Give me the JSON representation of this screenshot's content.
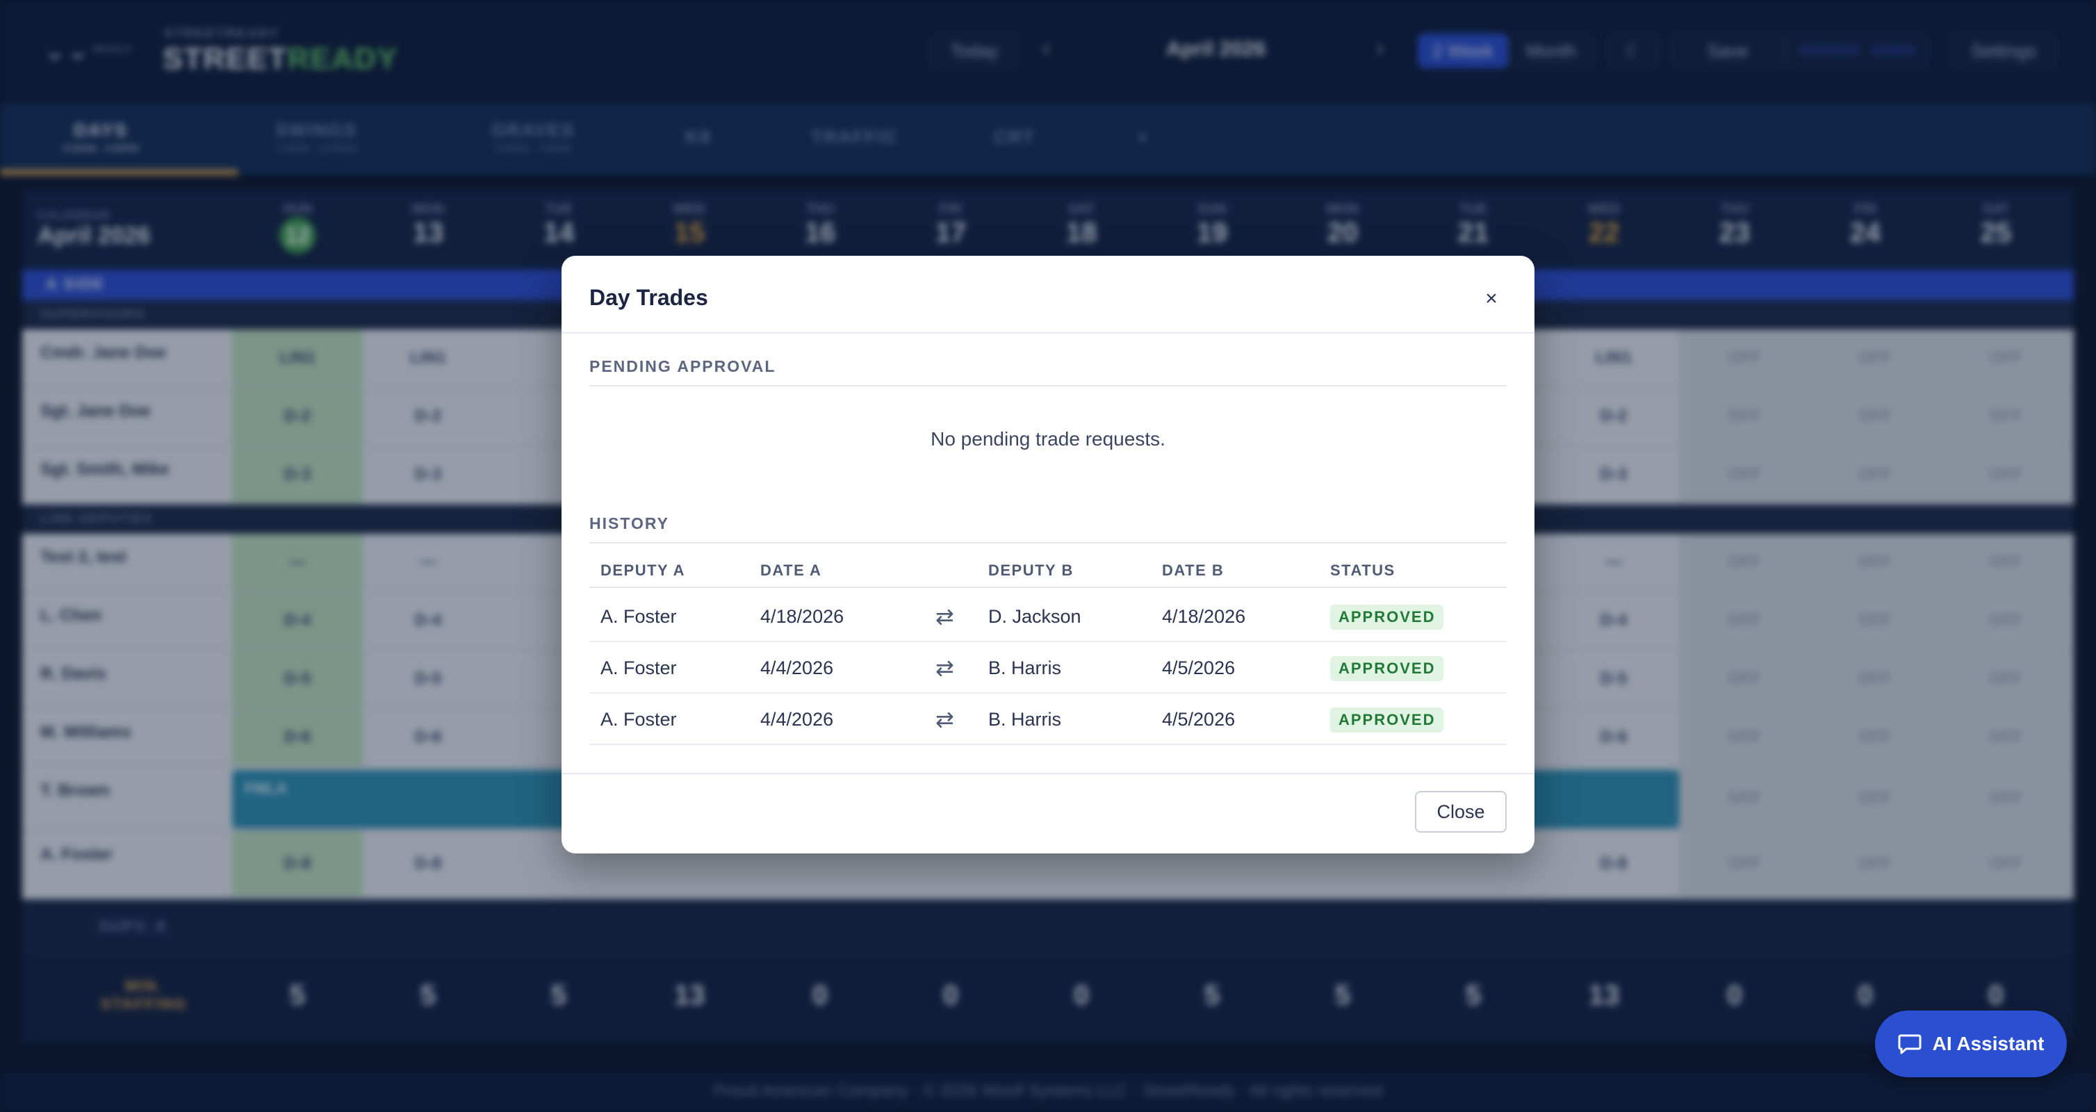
{
  "app": {
    "brand_small": "WOOLF",
    "brand_sub": "STREETREADY",
    "brand_part1": "STREET",
    "brand_part2": "READY",
    "today_label": "Today",
    "month_label": "April 2026",
    "view_week": "2 Week",
    "view_month": "Month",
    "save_label": "Save",
    "user_label": "ANDREW · ADMIN",
    "settings_label": "Settings",
    "tabs": [
      {
        "label": "DAYS",
        "sub": "6:00AM - 4:00PM"
      },
      {
        "label": "SWINGS",
        "sub": "2:00PM - 12:00PM"
      },
      {
        "label": "GRAVES",
        "sub": "9:00PM - 7:00AM"
      },
      {
        "label": "K9",
        "sub": ""
      },
      {
        "label": "TRAFFIC",
        "sub": ""
      },
      {
        "label": "CRT",
        "sub": ""
      },
      {
        "label": "+",
        "sub": ""
      }
    ],
    "calendar_label": "CALENDAR",
    "calendar_month": "April 2026",
    "days": [
      {
        "dn": "SUN",
        "dd": "12"
      },
      {
        "dn": "MON",
        "dd": "13"
      },
      {
        "dn": "TUE",
        "dd": "14"
      },
      {
        "dn": "WED",
        "dd": "15"
      },
      {
        "dn": "THU",
        "dd": "16"
      },
      {
        "dn": "FRI",
        "dd": "17"
      },
      {
        "dn": "SAT",
        "dd": "18"
      },
      {
        "dn": "SUN",
        "dd": "19"
      },
      {
        "dn": "MON",
        "dd": "20"
      },
      {
        "dn": "TUE",
        "dd": "21"
      },
      {
        "dn": "WED",
        "dd": "22"
      },
      {
        "dn": "THU",
        "dd": "23"
      },
      {
        "dn": "FRI",
        "dd": "24"
      },
      {
        "dn": "SAT",
        "dd": "25"
      }
    ],
    "side_a": "A SIDE",
    "supervisors_label": "SUPERVISORS",
    "line_deputies_label": "LINE DEPUTIES",
    "rows": [
      {
        "name": "Cmdr. Jane Doe",
        "code": "LIN1"
      },
      {
        "name": "Sgt. Jane Doe",
        "code": "D-2"
      },
      {
        "name": "Sgt. Smith, Mike",
        "code": "D-3"
      },
      {
        "name": "Test 2, test",
        "code": "—"
      },
      {
        "name": "L. Chen",
        "code": "D-4"
      },
      {
        "name": "R. Davis",
        "code": "D-5"
      },
      {
        "name": "M. Williams",
        "code": "D-6"
      },
      {
        "name": "T. Brown",
        "code": ""
      },
      {
        "name": "A. Foster",
        "code": "D-8"
      }
    ],
    "off_label": "OFF",
    "fmla_label": "FMLA",
    "supv_label": "SUPV. A",
    "min_staffing_label": "MIN. STAFFING",
    "staffing": [
      "5",
      "5",
      "5",
      "13",
      "0",
      "0",
      "0",
      "5",
      "5",
      "5",
      "13",
      "0",
      "0",
      "0"
    ],
    "footer": "Proud American Company · © 2026 Woolf Systems LLC · StreetReady · All rights reserved"
  },
  "modal": {
    "title": "Day Trades",
    "close_x": "×",
    "pending_title": "PENDING APPROVAL",
    "pending_empty": "No pending trade requests.",
    "history_title": "HISTORY",
    "columns": {
      "deputy_a": "DEPUTY A",
      "date_a": "DATE A",
      "deputy_b": "DEPUTY B",
      "date_b": "DATE B",
      "status": "STATUS"
    },
    "swap_glyph": "⇄",
    "history": [
      {
        "deputy_a": "A. Foster",
        "date_a": "4/18/2026",
        "deputy_b": "D. Jackson",
        "date_b": "4/18/2026",
        "status": "APPROVED"
      },
      {
        "deputy_a": "A. Foster",
        "date_a": "4/4/2026",
        "deputy_b": "B. Harris",
        "date_b": "4/5/2026",
        "status": "APPROVED"
      },
      {
        "deputy_a": "A. Foster",
        "date_a": "4/4/2026",
        "deputy_b": "B. Harris",
        "date_b": "4/5/2026",
        "status": "APPROVED"
      }
    ],
    "close_label": "Close"
  },
  "assistant": {
    "label": "AI Assistant"
  },
  "colors": {
    "accent": "#2a4fd0",
    "approved_bg": "#e1f4e4",
    "approved_text": "#1f7a35"
  }
}
